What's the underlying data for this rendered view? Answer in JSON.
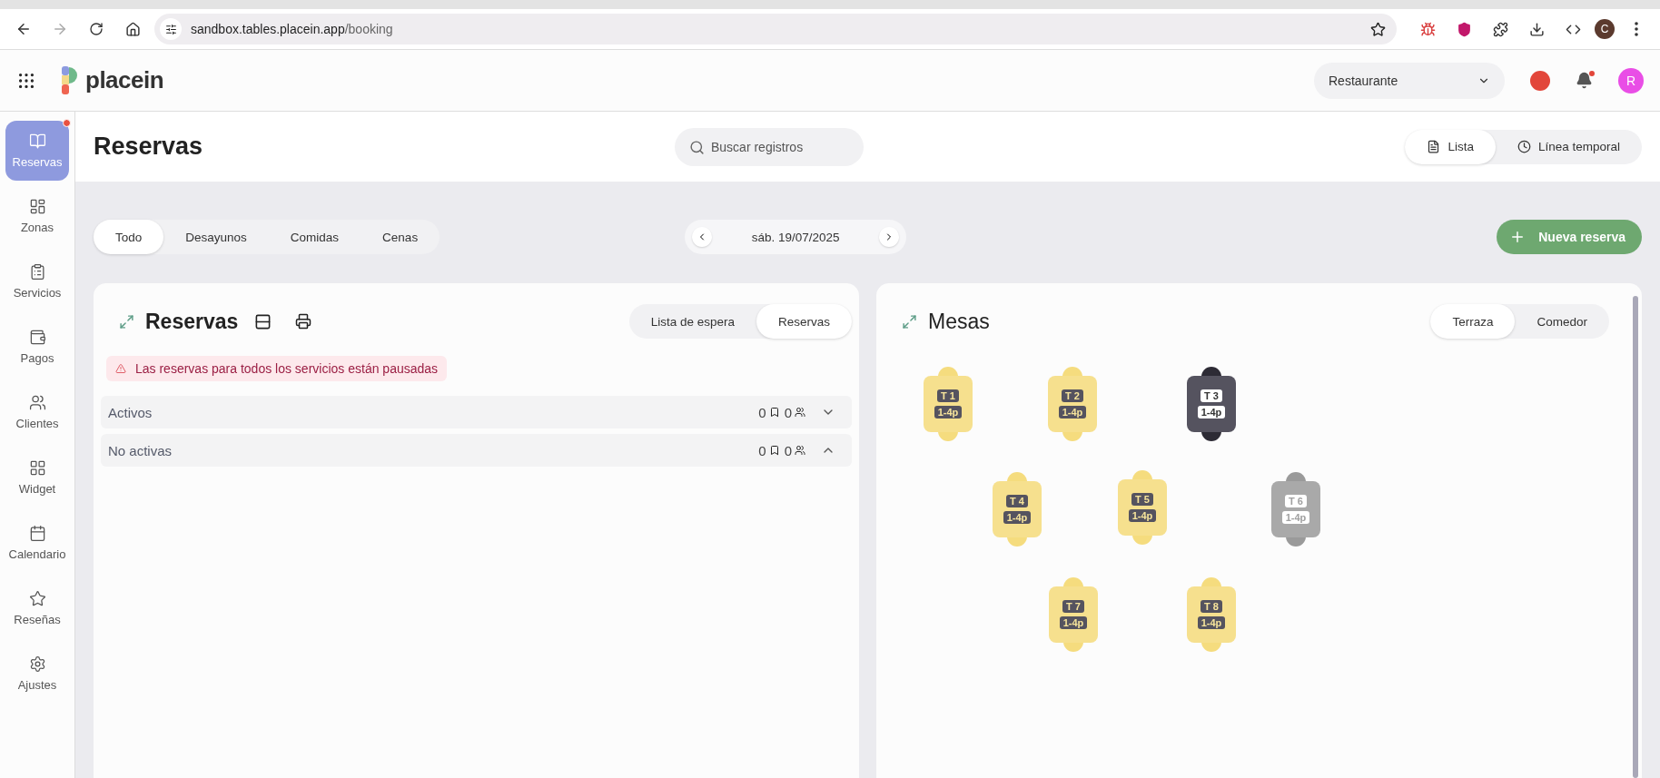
{
  "browser": {
    "url_host": "sandbox.tables.placein.app",
    "url_path": "/booking",
    "profile": "C"
  },
  "header": {
    "logo": "placein",
    "venue": "Restaurante",
    "avatar": "R",
    "notification": true
  },
  "sidebar": {
    "items": [
      {
        "kind": "reservas",
        "label": "Reservas",
        "selected": true,
        "badge": true
      },
      {
        "kind": "zonas",
        "label": "Zonas",
        "selected": false,
        "badge": false
      },
      {
        "kind": "servicios",
        "label": "Servicios",
        "selected": false,
        "badge": false
      },
      {
        "kind": "pagos",
        "label": "Pagos",
        "selected": false,
        "badge": false
      },
      {
        "kind": "clientes",
        "label": "Clientes",
        "selected": false,
        "badge": false
      },
      {
        "kind": "widget",
        "label": "Widget",
        "selected": false,
        "badge": false
      },
      {
        "kind": "calendario",
        "label": "Calendario",
        "selected": false,
        "badge": false
      },
      {
        "kind": "resenas",
        "label": "Reseñas",
        "selected": false,
        "badge": false
      },
      {
        "kind": "ajustes",
        "label": "Ajustes",
        "selected": false,
        "badge": false
      }
    ]
  },
  "page": {
    "title": "Reservas",
    "search": {
      "placeholder": "Buscar registros"
    },
    "views": [
      {
        "kind": "lista",
        "label": "Lista",
        "selected": true
      },
      {
        "kind": "timeline",
        "label": "Línea temporal",
        "selected": false
      }
    ]
  },
  "services": [
    {
      "label": "Todo",
      "selected": true
    },
    {
      "label": "Desayunos",
      "selected": false
    },
    {
      "label": "Comidas",
      "selected": false
    },
    {
      "label": "Cenas",
      "selected": false
    }
  ],
  "date": "sáb. 19/07/2025",
  "new_button": "Nueva reserva",
  "reservations": {
    "title": "Reservas",
    "toggle": [
      {
        "label": "Lista de espera",
        "selected": false
      },
      {
        "label": "Reservas",
        "selected": true
      }
    ],
    "alert": "Las reservas para todos los servicios están pausadas",
    "groups": [
      {
        "label": "Activos",
        "bookings": "0",
        "guests": "0",
        "expanded": false
      },
      {
        "label": "No activas",
        "bookings": "0",
        "guests": "0",
        "expanded": true
      }
    ]
  },
  "tables": {
    "title": "Mesas",
    "zones": [
      {
        "label": "Terraza",
        "selected": true
      },
      {
        "label": "Comedor",
        "selected": false
      }
    ],
    "items": [
      {
        "name": "T 1",
        "capacity": "1-4p",
        "kind": "free"
      },
      {
        "name": "T 2",
        "capacity": "1-4p",
        "kind": "free"
      },
      {
        "name": "T 3",
        "capacity": "1-4p",
        "kind": "occupied"
      },
      {
        "name": "T 4",
        "capacity": "1-4p",
        "kind": "free"
      },
      {
        "name": "T 5",
        "capacity": "1-4p",
        "kind": "free"
      },
      {
        "name": "T 6",
        "capacity": "1-4p",
        "kind": "blocked"
      },
      {
        "name": "T 7",
        "capacity": "1-4p",
        "kind": "free"
      },
      {
        "name": "T 8",
        "capacity": "1-4p",
        "kind": "free"
      }
    ]
  }
}
